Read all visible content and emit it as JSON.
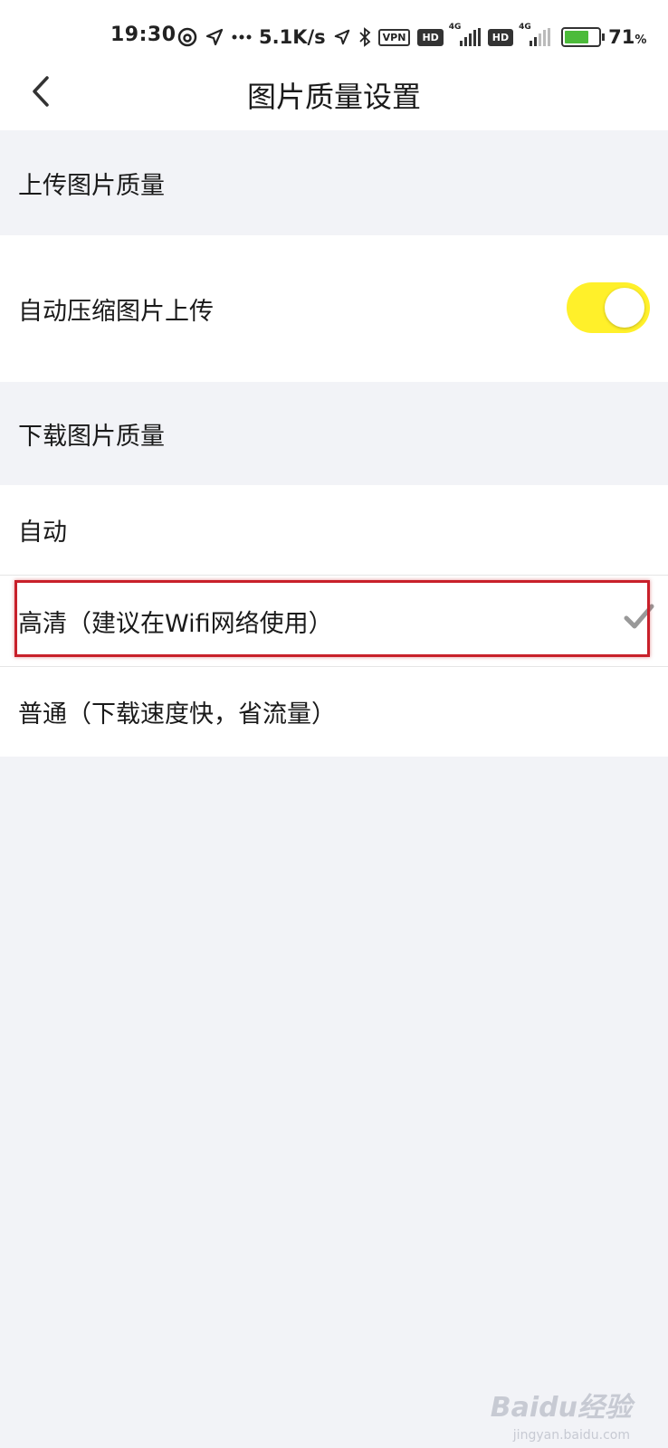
{
  "status_bar": {
    "time": "19:30",
    "net_speed": "5.1K/s",
    "vpn": "VPN",
    "hd_badge": "HD",
    "sim_tag": "4G",
    "battery_percent": "71",
    "percent_sign": "%",
    "battery_level": 0.71,
    "battery_color": "#4cbb3a"
  },
  "header": {
    "title": "图片质量设置"
  },
  "upload_section": {
    "label": "上传图片质量",
    "auto_compress": {
      "label": "自动压缩图片上传",
      "enabled": true,
      "toggle_color": "#fff02a"
    }
  },
  "download_section": {
    "label": "下载图片质量",
    "options": [
      {
        "label": "自动",
        "selected": false
      },
      {
        "label": "高清（建议在Wifi网络使用）",
        "selected": true
      },
      {
        "label": "普通（下载速度快，省流量）",
        "selected": false
      }
    ]
  },
  "colors": {
    "background": "#f2f3f7",
    "highlight_border": "#c8202a",
    "checkmark": "#999999"
  },
  "watermark": {
    "text": "Baidu经验",
    "sub": "jingyan.baidu.com"
  }
}
